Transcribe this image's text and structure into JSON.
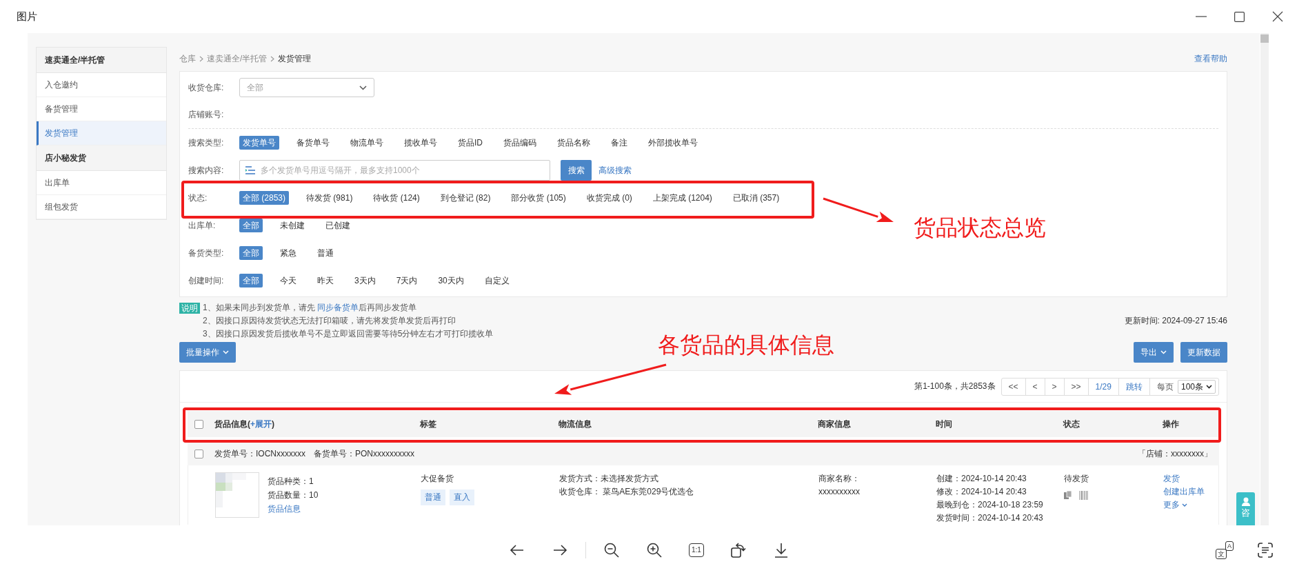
{
  "window": {
    "title": "图片"
  },
  "sidebar": [
    {
      "title": "速卖通全/半托管",
      "items": [
        {
          "label": "入仓邀约",
          "selected": false
        },
        {
          "label": "备货管理",
          "selected": false
        },
        {
          "label": "发货管理",
          "selected": true
        }
      ]
    },
    {
      "title": "店小秘发货",
      "items": [
        {
          "label": "出库单",
          "selected": false
        },
        {
          "label": "组包发货",
          "selected": false
        }
      ]
    }
  ],
  "breadcrumb": [
    "仓库",
    "速卖通全/半托管",
    "发货管理"
  ],
  "help_link": "查看帮助",
  "filters": [
    {
      "kind": "select",
      "label": "收货仓库:",
      "value": "全部",
      "divider_after": false,
      "highlighted": false
    },
    {
      "kind": "blank",
      "label": "店铺账号:",
      "divider_after": true,
      "highlighted": false
    },
    {
      "kind": "options",
      "label": "搜索类型:",
      "divider_after": false,
      "highlighted": false,
      "options": [
        {
          "label": "发货单号",
          "selected": true
        },
        {
          "label": "备货单号",
          "selected": false
        },
        {
          "label": "物流单号",
          "selected": false
        },
        {
          "label": "揽收单号",
          "selected": false
        },
        {
          "label": "货品ID",
          "selected": false
        },
        {
          "label": "货品编码",
          "selected": false
        },
        {
          "label": "货品名称",
          "selected": false
        },
        {
          "label": "备注",
          "selected": false
        },
        {
          "label": "外部揽收单号",
          "selected": false
        }
      ]
    },
    {
      "kind": "search",
      "label": "搜索内容:",
      "placeholder": "多个发货单号用逗号隔开，最多支持1000个",
      "button": "搜索",
      "link": "高级搜索",
      "divider_after": false,
      "highlighted": false
    },
    {
      "kind": "options",
      "label": "状态:",
      "divider_after": false,
      "highlighted": true,
      "options": [
        {
          "label": "全部 (2853)",
          "selected": true
        },
        {
          "label": "待发货 (981)",
          "selected": false
        },
        {
          "label": "待收货 (124)",
          "selected": false
        },
        {
          "label": "到仓登记 (82)",
          "selected": false
        },
        {
          "label": "部分收货 (105)",
          "selected": false
        },
        {
          "label": "收货完成 (0)",
          "selected": false
        },
        {
          "label": "上架完成 (1204)",
          "selected": false
        },
        {
          "label": "已取消 (357)",
          "selected": false
        }
      ]
    },
    {
      "kind": "options",
      "label": "出库单:",
      "divider_after": false,
      "highlighted": false,
      "options": [
        {
          "label": "全部",
          "selected": true
        },
        {
          "label": "未创建",
          "selected": false
        },
        {
          "label": "已创建",
          "selected": false
        }
      ]
    },
    {
      "kind": "options",
      "label": "备货类型:",
      "divider_after": false,
      "highlighted": false,
      "options": [
        {
          "label": "全部",
          "selected": true
        },
        {
          "label": "紧急",
          "selected": false
        },
        {
          "label": "普通",
          "selected": false
        }
      ]
    },
    {
      "kind": "options",
      "label": "创建时间:",
      "divider_after": false,
      "highlighted": false,
      "options": [
        {
          "label": "全部",
          "selected": true
        },
        {
          "label": "今天",
          "selected": false
        },
        {
          "label": "昨天",
          "selected": false
        },
        {
          "label": "3天内",
          "selected": false
        },
        {
          "label": "7天内",
          "selected": false
        },
        {
          "label": "30天内",
          "selected": false
        },
        {
          "label": "自定义",
          "selected": false
        }
      ]
    }
  ],
  "notes": {
    "badge": "说明",
    "lines": [
      {
        "text": "1、如果未同步到发货单，请先 ",
        "link": "同步备货单",
        "after": "后再同步发货单"
      },
      {
        "text": "2、因接口原因待发货状态无法打印箱唛，请先将发货单发货后再打印"
      },
      {
        "text": "3、因接口原因发货后揽收单号不是立即返回需要等待5分钟左右才可打印揽收单"
      }
    ]
  },
  "updated": "更新时间: 2024-09-27 15:46",
  "batch_button": "批量操作",
  "export_button": "导出",
  "refresh_button": "更新数据",
  "pager": {
    "summary": "第1-100条，共2853条",
    "controls": [
      {
        "label": "<<",
        "kind": "nav"
      },
      {
        "label": "<",
        "kind": "nav"
      },
      {
        "label": ">",
        "kind": "nav"
      },
      {
        "label": ">>",
        "kind": "nav"
      },
      {
        "label": "1/29",
        "kind": "page"
      },
      {
        "label": "跳转",
        "kind": "link"
      }
    ],
    "per_page_label": "每页",
    "per_page": "100条"
  },
  "table": {
    "checked": false,
    "highlighted": true,
    "columns": [
      {
        "label": "货品信息(",
        "link": "+展开",
        "after": ")"
      },
      {
        "label": "标签"
      },
      {
        "label": "物流信息"
      },
      {
        "label": "商家信息"
      },
      {
        "label": "时间"
      },
      {
        "label": "状态"
      },
      {
        "label": "操作"
      }
    ]
  },
  "orders": [
    {
      "checked": false,
      "shipment_no": "发货单号：IOCNxxxxxxx",
      "stock_no": "备货单号：PONxxxxxxxxxx",
      "shop": "「店铺：xxxxxxxx」",
      "kinds": "货品种类：1",
      "quantity": "货品数量：10",
      "info_link": "货品信息",
      "tag_title": "大促备货",
      "tags": [
        "普通",
        "直入"
      ],
      "logistics": [
        "发货方式：未选择发货方式",
        "收货仓库：  菜鸟AE东莞029号优选仓"
      ],
      "merchant": [
        "商家名称：",
        "xxxxxxxxxx"
      ],
      "times": [
        "创建：2024-10-14 20:43",
        "修改：2024-10-14 20:43",
        "最晚到仓：2024-10-18 23:59",
        "发货时间：2024-10-14 20:43"
      ],
      "status": "待发货",
      "actions": [
        {
          "label": "发货",
          "dropdown": false
        },
        {
          "label": "创建出库单",
          "dropdown": false
        },
        {
          "label": "更多",
          "dropdown": true
        }
      ]
    }
  ],
  "annotations": [
    {
      "text": "货品状态总览"
    },
    {
      "text": "各货品的具体信息"
    }
  ],
  "consult": "咨",
  "toolbar": {
    "actual_size": "1:1",
    "translate": [
      "文",
      "A"
    ]
  }
}
